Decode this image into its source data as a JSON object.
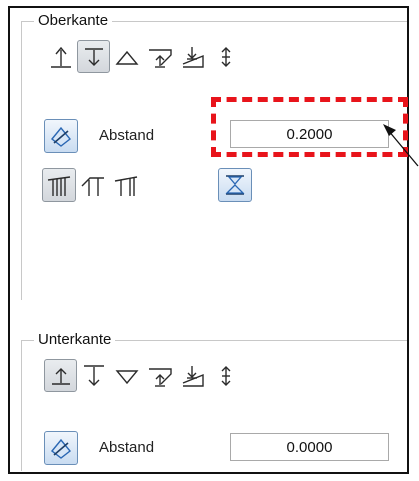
{
  "top_group": {
    "title": "Oberkante",
    "distance_label": "Abstand",
    "distance_value": "0.2000",
    "icons": [
      "edge-align-top-icon",
      "edge-align-bottom-icon",
      "triangle-up-icon",
      "slope-up-icon",
      "slope-down-icon",
      "up-down-arrow-icon"
    ],
    "selected_icon": "edge-align-bottom-icon",
    "profile_icons": [
      "roof-profile-a-icon",
      "roof-profile-b-icon",
      "roof-profile-c-icon"
    ],
    "selected_profile": "roof-profile-a-icon"
  },
  "bottom_group": {
    "title": "Unterkante",
    "distance_label": "Abstand",
    "distance_value": "0.0000",
    "icons": [
      "edge-align-top-icon",
      "edge-align-bottom-icon",
      "triangle-down-icon",
      "slope-up-icon",
      "slope-down-icon",
      "up-down-arrow-icon"
    ],
    "selected_icon": "edge-align-top-icon"
  },
  "colors": {
    "highlight": "#e8141b",
    "accent_blue": "#2a67b3",
    "icon_stroke": "#2b2b2b"
  }
}
